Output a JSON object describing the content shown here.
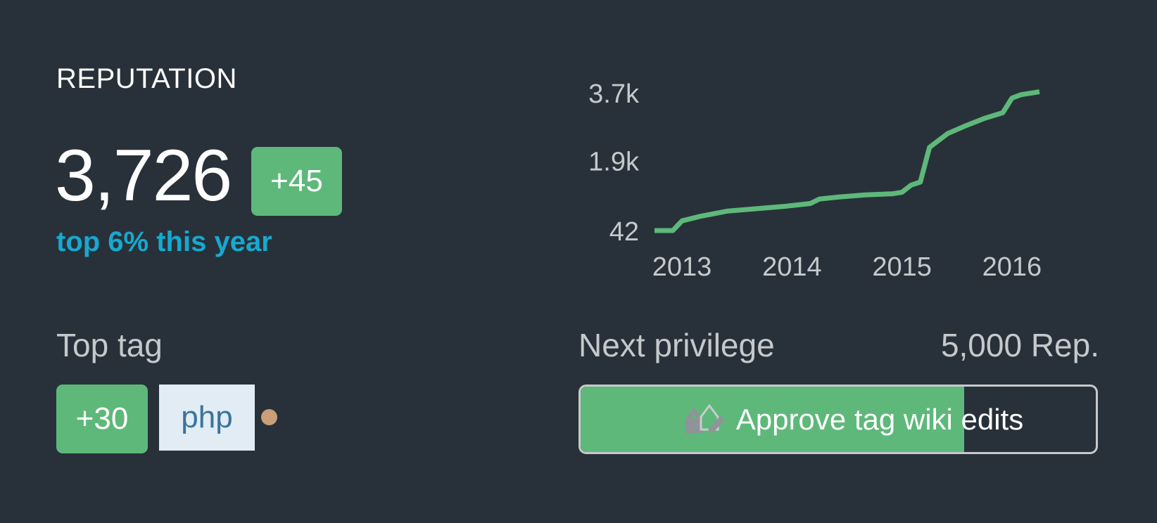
{
  "reputation": {
    "heading": "REPUTATION",
    "value": "3,726",
    "change": "+45",
    "rank": "top 6% this year"
  },
  "top_tag": {
    "label": "Top tag",
    "score": "+30",
    "tag": "php",
    "badge_color": "#c9a07a"
  },
  "next_privilege": {
    "label": "Next privilege",
    "rep_required": "5,000 Rep.",
    "name": "Approve tag wiki edits",
    "icon": "tag-edit-icon",
    "progress_fraction": 0.745
  },
  "colors": {
    "background": "#283139",
    "accent_green": "#5eb87a",
    "rank_blue": "#16a9d1",
    "tag_bg": "#e1ecf4",
    "tag_text": "#39739d"
  },
  "chart_data": {
    "type": "line",
    "title": "",
    "xlabel": "",
    "ylabel": "",
    "x_ticks": [
      "2013",
      "2014",
      "2015",
      "2016"
    ],
    "y_ticks": [
      "42",
      "1.9k",
      "3.7k"
    ],
    "y_tick_values": [
      42,
      1900,
      3700
    ],
    "series": [
      {
        "points": [
          [
            "2012-10",
            42
          ],
          [
            "2012-12",
            42
          ],
          [
            "2013-01",
            300
          ],
          [
            "2013-03",
            420
          ],
          [
            "2013-06",
            560
          ],
          [
            "2013-09",
            620
          ],
          [
            "2013-12",
            680
          ],
          [
            "2014-03",
            760
          ],
          [
            "2014-04",
            880
          ],
          [
            "2014-06",
            930
          ],
          [
            "2014-09",
            990
          ],
          [
            "2014-12",
            1020
          ],
          [
            "2015-01",
            1060
          ],
          [
            "2015-02",
            1250
          ],
          [
            "2015-03",
            1330
          ],
          [
            "2015-04",
            2250
          ],
          [
            "2015-06",
            2620
          ],
          [
            "2015-08",
            2830
          ],
          [
            "2015-10",
            3020
          ],
          [
            "2015-12",
            3170
          ],
          [
            "2016-01",
            3560
          ],
          [
            "2016-02",
            3650
          ],
          [
            "2016-04",
            3726
          ]
        ]
      }
    ],
    "grid": false,
    "legend": "none",
    "line_color": "#5eb87a"
  }
}
